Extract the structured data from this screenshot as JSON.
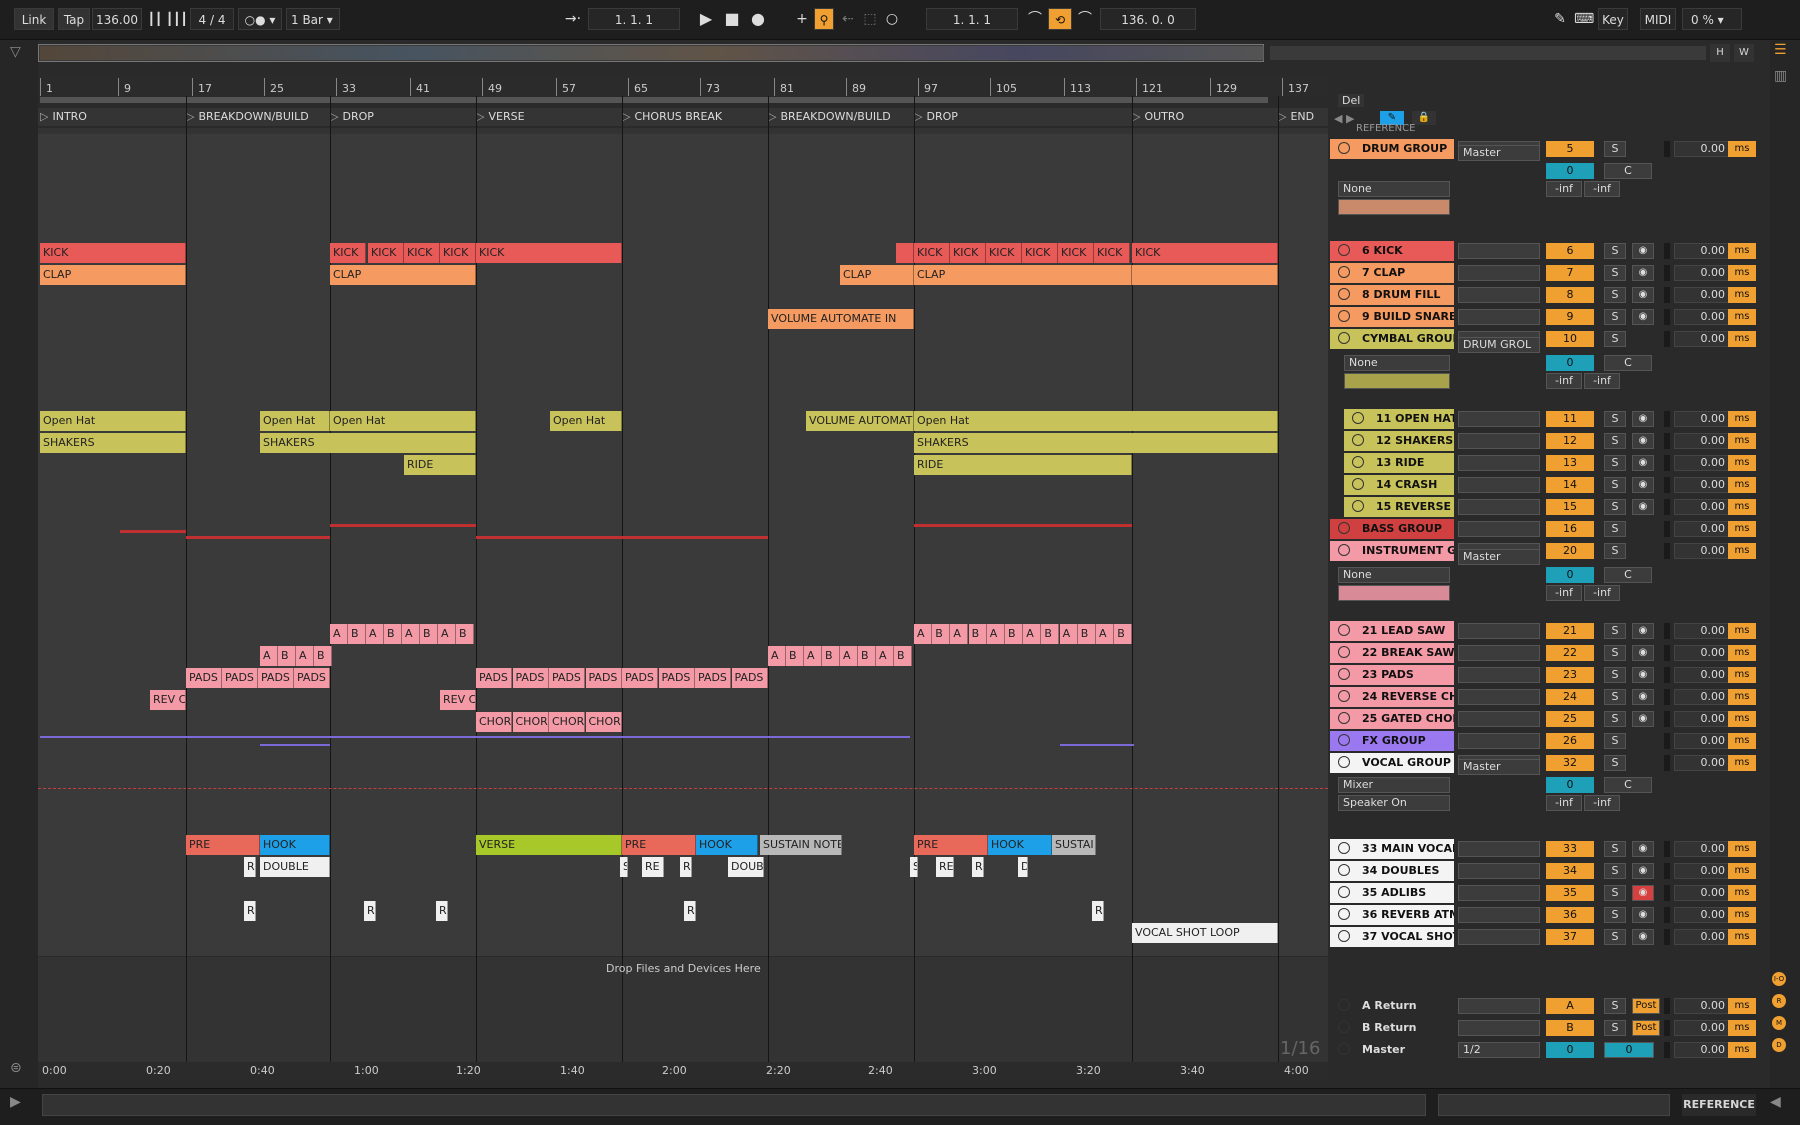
{
  "transport": {
    "link": "Link",
    "tap": "Tap",
    "tempo": "136.00",
    "signature": "4 / 4",
    "quantize": "1 Bar",
    "position": "1.  1.  1",
    "loop_start": "1.  1.  1",
    "loop_length": "136.  0.  0",
    "key": "Key",
    "midi": "MIDI",
    "cpu": "0 %"
  },
  "ruler": {
    "bars": [
      "1",
      "9",
      "17",
      "25",
      "33",
      "41",
      "49",
      "57",
      "65",
      "73",
      "81",
      "89",
      "97",
      "105",
      "113",
      "121",
      "129",
      "137"
    ],
    "times": [
      "0:00",
      "0:20",
      "0:40",
      "1:00",
      "1:20",
      "1:40",
      "2:00",
      "2:20",
      "2:40",
      "3:00",
      "3:20",
      "3:40",
      "4:00"
    ]
  },
  "locators": [
    "INTRO",
    "BREAKDOWN/BUILD",
    "DROP",
    "VERSE",
    "CHORUS BREAK",
    "BREAKDOWN/BUILD",
    "DROP",
    "OUTRO",
    "END"
  ],
  "arrangement": {
    "drop_hint": "Drop Files and Devices Here",
    "grid": "1/16",
    "clips": {
      "kick": "KICK",
      "clap": "CLAP",
      "vol_auto": "VOLUME AUTOMATE IN",
      "vol_auto2": "VOLUME AUTOMAT",
      "open_hat": "Open Hat",
      "shakers": "SHAKERS",
      "ride": "RIDE",
      "a": "A",
      "b": "B",
      "pads": "PADS",
      "rev": "REV C",
      "chor": "CHOR",
      "pre": "PRE",
      "hook": "HOOK",
      "verse": "VERSE",
      "sustain": "SUSTAIN NOTE",
      "sustain2": "SUSTAI",
      "double": "DOUBLE",
      "doub": "DOUB",
      "re": "RE",
      "r": "R",
      "d": "D",
      "s": "S",
      "vocal_shot_loop": "VOCAL SHOT LOOP"
    }
  },
  "mixer": {
    "del": "Del",
    "reference_top": "REFERENCE",
    "master_label": "Master",
    "none_label": "None",
    "mixer_label": "Mixer",
    "speaker_on": "Speaker On",
    "drum_grol": "DRUM GROL",
    "s_label": "S",
    "c_label": "C",
    "inf": "-inf",
    "delay_val": "0.00",
    "ms": "ms",
    "zero": "0",
    "post": "Post",
    "half": "1/2",
    "tracks": [
      {
        "name": "DRUM GROUP",
        "num": "5",
        "color": "#f59a60"
      },
      {
        "name": "6 KICK",
        "num": "6",
        "color": "#e85a58"
      },
      {
        "name": "7 CLAP",
        "num": "7",
        "color": "#f59a60"
      },
      {
        "name": "8 DRUM FILL",
        "num": "8",
        "color": "#f59a60"
      },
      {
        "name": "9 BUILD SNARE",
        "num": "9",
        "color": "#f59a60"
      },
      {
        "name": "CYMBAL GROUP",
        "num": "10",
        "color": "#c8c25a"
      },
      {
        "name": "11 OPEN HAT",
        "num": "11",
        "color": "#c8c25a"
      },
      {
        "name": "12 SHAKERS",
        "num": "12",
        "color": "#c8c25a"
      },
      {
        "name": "13 RIDE",
        "num": "13",
        "color": "#c8c25a"
      },
      {
        "name": "14 CRASH",
        "num": "14",
        "color": "#c8c25a"
      },
      {
        "name": "15 REVERSE C",
        "num": "15",
        "color": "#c8c25a"
      },
      {
        "name": "BASS GROUP",
        "num": "16",
        "color": "#d04040"
      },
      {
        "name": "INSTRUMENT GR",
        "num": "20",
        "color": "#f39aa6"
      },
      {
        "name": "21 LEAD SAW",
        "num": "21",
        "color": "#f39aa6"
      },
      {
        "name": "22 BREAK SAW",
        "num": "22",
        "color": "#f39aa6"
      },
      {
        "name": "23 PADS",
        "num": "23",
        "color": "#f39aa6"
      },
      {
        "name": "24 REVERSE CH",
        "num": "24",
        "color": "#f39aa6"
      },
      {
        "name": "25 GATED CHOR",
        "num": "25",
        "color": "#f39aa6"
      },
      {
        "name": "FX GROUP",
        "num": "26",
        "color": "#9a78f0"
      },
      {
        "name": "VOCAL GROUP",
        "num": "32",
        "color": "#f4f4f4"
      },
      {
        "name": "33 MAIN VOCAL",
        "num": "33",
        "color": "#f4f4f4"
      },
      {
        "name": "34 DOUBLES",
        "num": "34",
        "color": "#f4f4f4"
      },
      {
        "name": "35 ADLIBS",
        "num": "35",
        "color": "#f4f4f4"
      },
      {
        "name": "36 REVERB ATM",
        "num": "36",
        "color": "#f4f4f4"
      },
      {
        "name": "37 VOCAL SHOT",
        "num": "37",
        "color": "#f4f4f4"
      }
    ],
    "returns": [
      {
        "name": "A Return",
        "letter": "A"
      },
      {
        "name": "B Return",
        "letter": "B"
      },
      {
        "name": "Master",
        "letter": "0"
      }
    ]
  },
  "right_icons": [
    "I-O",
    "R",
    "M",
    "D"
  ],
  "status": {
    "reference_button": "REFERENCE"
  }
}
